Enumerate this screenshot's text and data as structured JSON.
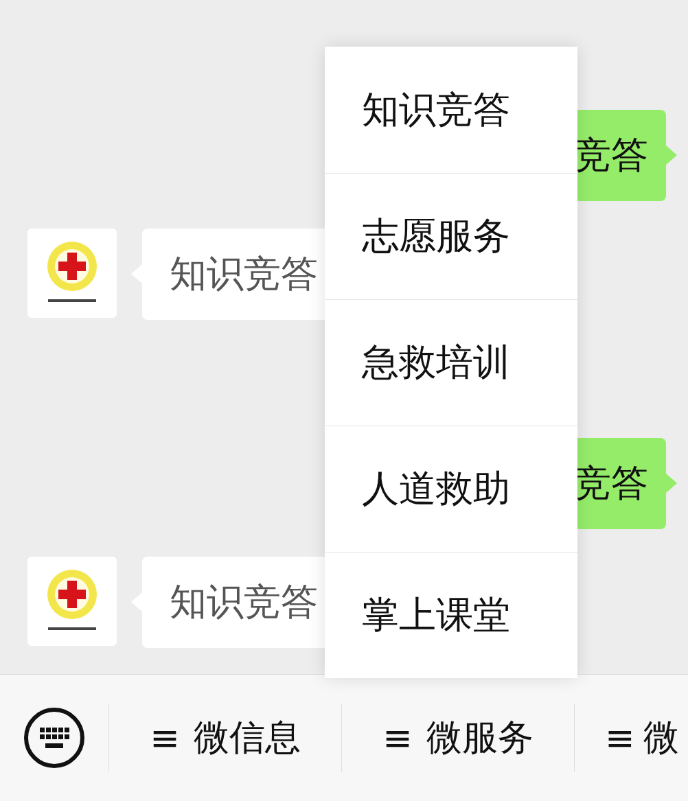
{
  "messages": [
    {
      "kind": "outgoing",
      "text": "竞答"
    },
    {
      "kind": "incoming",
      "text": "知识竞答"
    },
    {
      "kind": "outgoing",
      "text": "竞答"
    },
    {
      "kind": "incoming",
      "text": "知识竞答"
    }
  ],
  "popup_menu": {
    "items": [
      "知识竞答",
      "志愿服务",
      "急救培训",
      "人道救助",
      "掌上课堂"
    ]
  },
  "bottom_menu": {
    "items": [
      {
        "icon": "≡",
        "label": "微信息"
      },
      {
        "icon": "≡",
        "label": "微服务"
      },
      {
        "icon": "≡",
        "label": "微"
      }
    ]
  }
}
